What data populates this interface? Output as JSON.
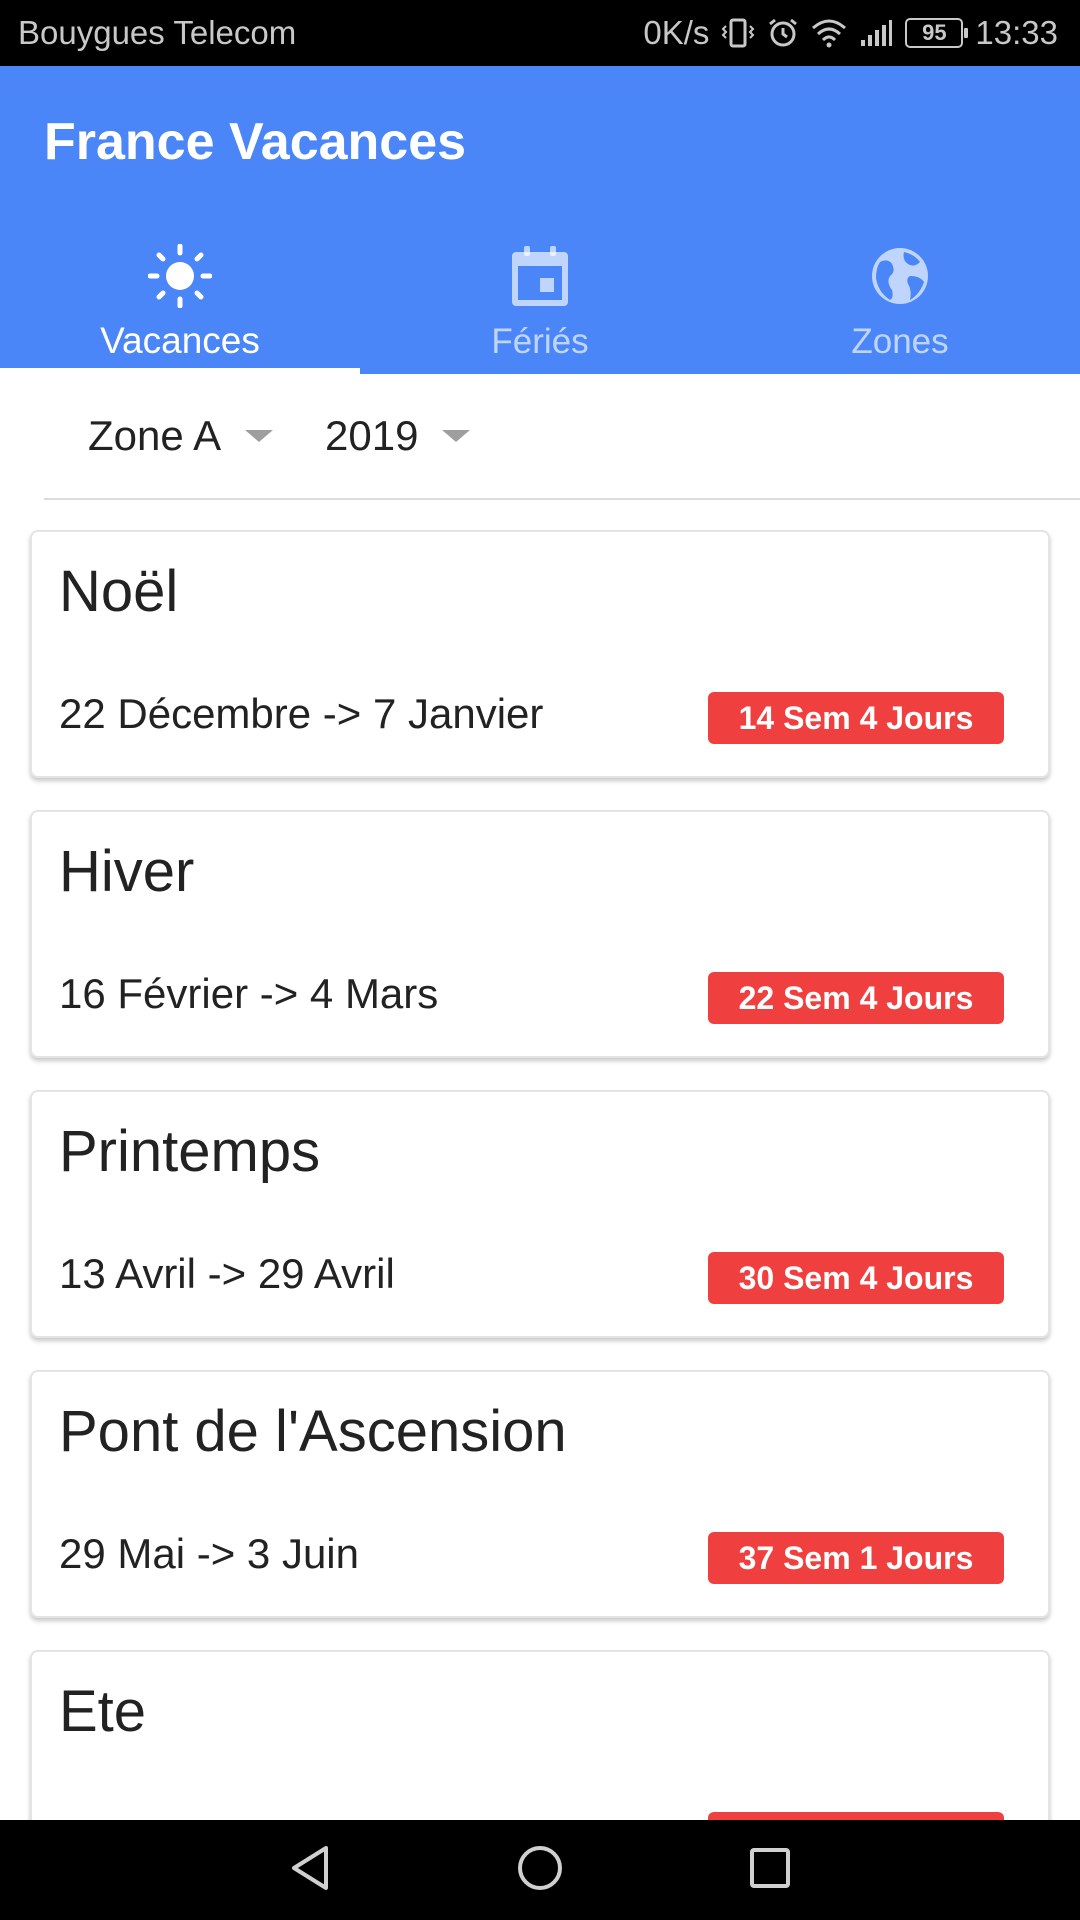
{
  "status_bar": {
    "carrier": "Bouygues Telecom",
    "speed": "0K/s",
    "battery": "95",
    "time": "13:33"
  },
  "app": {
    "title": "France Vacances",
    "accent_color": "#4a86f7",
    "badge_color": "#f03f3f"
  },
  "tabs": [
    {
      "label": "Vacances",
      "icon": "sun-icon",
      "active": true
    },
    {
      "label": "Fériés",
      "icon": "calendar-icon",
      "active": false
    },
    {
      "label": "Zones",
      "icon": "globe-icon",
      "active": false
    }
  ],
  "filters": {
    "zone": "Zone A",
    "year": "2019"
  },
  "holidays": [
    {
      "name": "Noël",
      "dates": "22 Décembre -> 7 Janvier",
      "countdown": "14 Sem 4 Jours"
    },
    {
      "name": "Hiver",
      "dates": "16 Février -> 4 Mars",
      "countdown": "22 Sem 4 Jours"
    },
    {
      "name": "Printemps",
      "dates": "13 Avril -> 29 Avril",
      "countdown": "30 Sem 4 Jours"
    },
    {
      "name": "Pont de l'Ascension",
      "dates": "29 Mai -> 3 Juin",
      "countdown": "37 Sem 1 Jours"
    },
    {
      "name": "Ete",
      "dates": "",
      "countdown": ""
    }
  ],
  "nav": {
    "back": "back-icon",
    "home": "home-icon",
    "recents": "recents-icon"
  }
}
